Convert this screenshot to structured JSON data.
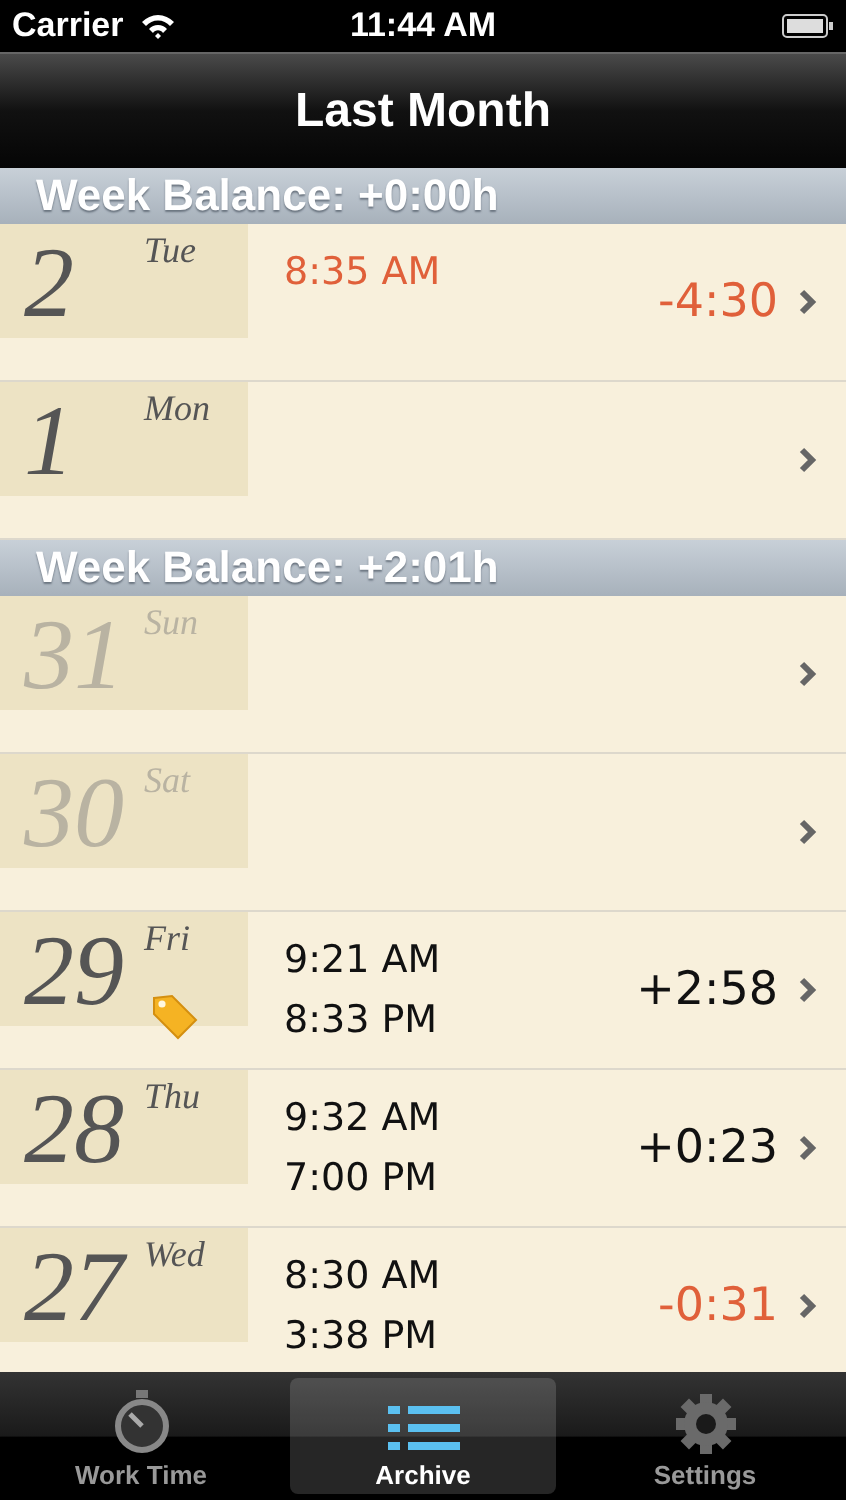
{
  "status_bar": {
    "carrier": "Carrier",
    "time": "11:44 AM"
  },
  "nav_bar": {
    "title": "Last Month"
  },
  "sections": [
    {
      "header": "Week Balance: +0:00h",
      "days": [
        {
          "day": "2",
          "weekday": "Tue",
          "dimmed": false,
          "tagged": false,
          "times": [
            "8:35 AM"
          ],
          "balance": "-4:30",
          "negative": true
        },
        {
          "day": "1",
          "weekday": "Mon",
          "dimmed": false,
          "tagged": false
        }
      ]
    },
    {
      "header": "Week Balance: +2:01h",
      "days": [
        {
          "day": "31",
          "weekday": "Sun",
          "dimmed": true,
          "tagged": false
        },
        {
          "day": "30",
          "weekday": "Sat",
          "dimmed": true,
          "tagged": false
        },
        {
          "day": "29",
          "weekday": "Fri",
          "dimmed": false,
          "tagged": true,
          "times": [
            "9:21 AM",
            "8:33 PM"
          ],
          "balance": "+2:58",
          "negative": false
        },
        {
          "day": "28",
          "weekday": "Thu",
          "dimmed": false,
          "tagged": false,
          "times": [
            "9:32 AM",
            "7:00 PM"
          ],
          "balance": "+0:23",
          "negative": false
        },
        {
          "day": "27",
          "weekday": "Wed",
          "dimmed": false,
          "tagged": false,
          "times": [
            "8:30 AM",
            "3:38 PM"
          ],
          "balance": "-0:31",
          "negative": true
        }
      ]
    }
  ],
  "tab_bar": [
    {
      "label": "Work Time",
      "kind": "stopwatch",
      "selected": false
    },
    {
      "label": "Archive",
      "kind": "list",
      "selected": true
    },
    {
      "label": "Settings",
      "kind": "gear",
      "selected": false
    }
  ]
}
